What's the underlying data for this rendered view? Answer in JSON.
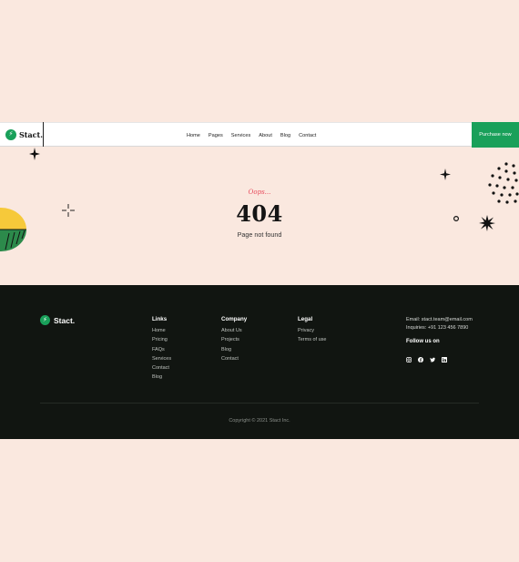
{
  "brand": {
    "name": "Stact."
  },
  "header": {
    "nav": [
      "Home",
      "Pages",
      "Services",
      "About",
      "Blog",
      "Contact"
    ],
    "cta_label": "Purchase now"
  },
  "hero": {
    "kicker": "Oops...",
    "code": "404",
    "message": "Page not found"
  },
  "footer": {
    "brand": "Stact.",
    "columns": [
      {
        "title": "Links",
        "items": [
          "Home",
          "Pricing",
          "FAQs",
          "Services",
          "Contact",
          "Blog"
        ]
      },
      {
        "title": "Company",
        "items": [
          "About Us",
          "Projects",
          "Blog",
          "Contact"
        ]
      },
      {
        "title": "Legal",
        "items": [
          "Privacy",
          "Terms of use"
        ]
      }
    ],
    "email": "Email: stact.team@email.com",
    "phone": "Inquiries: +91 123 456 7890",
    "follow_title": "Follow us on",
    "socials": [
      "instagram-icon",
      "facebook-icon",
      "twitter-icon",
      "linkedin-icon"
    ],
    "copyright": "Copyright © 2021 Stact Inc."
  },
  "colors": {
    "page_bg": "#fae8df",
    "accent": "#19a05a",
    "footer_bg": "#111511",
    "kicker": "#e74b5c"
  }
}
